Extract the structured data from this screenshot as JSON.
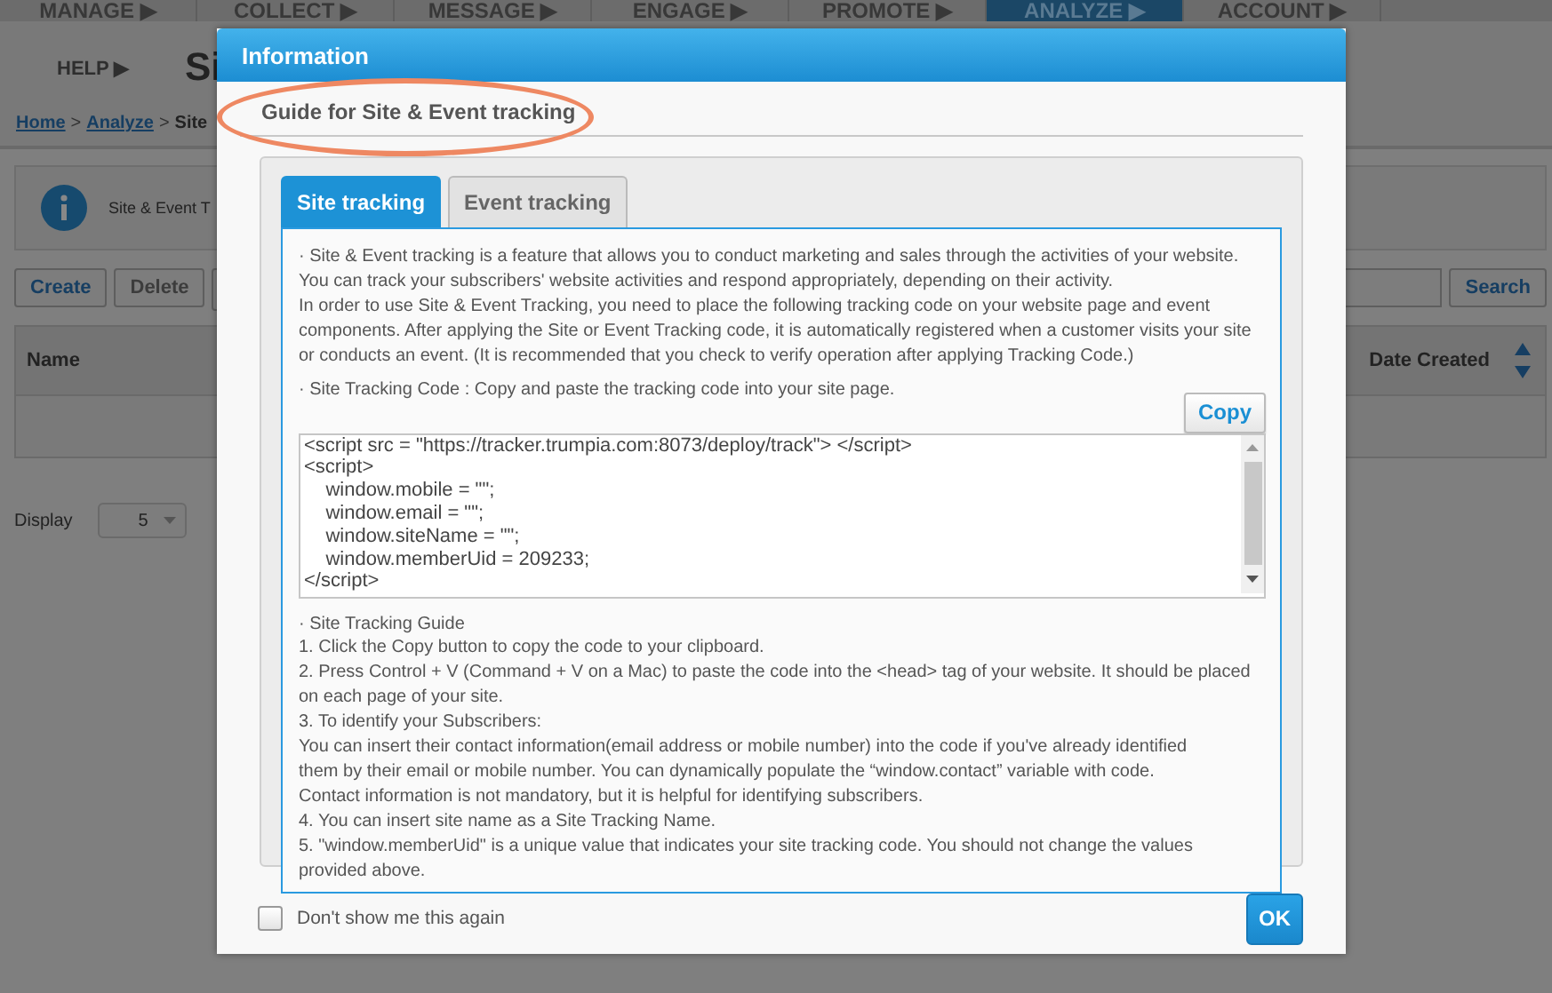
{
  "top_nav": [
    {
      "label": "MANAGE ▶",
      "selected": false
    },
    {
      "label": "COLLECT ▶",
      "selected": false
    },
    {
      "label": "MESSAGE ▶",
      "selected": false
    },
    {
      "label": "ENGAGE ▶",
      "selected": false
    },
    {
      "label": "PROMOTE ▶",
      "selected": false
    },
    {
      "label": "ANALYZE ▶",
      "selected": true
    },
    {
      "label": "ACCOUNT ▶",
      "selected": false
    }
  ],
  "page": {
    "help": "HELP ▶",
    "title": "Si",
    "breadcrumb": [
      {
        "kind": "link",
        "text": "Home"
      },
      {
        "kind": "sep",
        "text": ">"
      },
      {
        "kind": "link",
        "text": "Analyze"
      },
      {
        "kind": "sep",
        "text": ">"
      },
      {
        "kind": "current",
        "text": "Site"
      }
    ],
    "info_text": "Site & Event T",
    "toolbar": [
      {
        "label": "Create",
        "disabled": false
      },
      {
        "label": "Delete",
        "disabled": true
      }
    ],
    "search_button": "Search",
    "columns": [
      "Name",
      "Date Created"
    ],
    "display_label": "Display",
    "display_value": "5"
  },
  "dialog": {
    "title": "Information",
    "heading": "Guide for Site & Event tracking",
    "tabs": [
      {
        "label": "Site tracking",
        "selected": true
      },
      {
        "label": "Event tracking",
        "selected": false
      }
    ],
    "intro": [
      "· Site & Event tracking is a feature that allows you to conduct marketing and sales through the activities of your website. You can track your subscribers' website activities and respond appropriately, depending on their activity.",
      "In order to use Site & Event Tracking, you need to place the following tracking code on your website page and event components. After applying the Site or Event Tracking code, it is automatically registered when a customer visits your site or conducts an event. (It is recommended that you check to verify operation after applying Tracking Code.)"
    ],
    "code_label": "· Site Tracking Code : Copy and paste the tracking code into your site page.",
    "copy_button": "Copy",
    "code_lines": [
      "<script src = \"https://tracker.trumpia.com:8073/deploy/track\"> </script>",
      "<script>",
      "    window.mobile = \"\";",
      "    window.email = \"\";",
      "    window.siteName = \"\";",
      "    window.memberUid = 209233;",
      "</script>"
    ],
    "guide": [
      "· Site Tracking Guide",
      "1. Click the Copy button to copy the code to your clipboard.",
      "2. Press Control + V (Command + V on a Mac) to paste the code into the <head> tag of your website. It should be placed on each page of your site.",
      "3. To identify your Subscribers:",
      "You can insert their contact information(email address or mobile number) into the code if you've already identified",
      "them by their email or mobile number. You can dynamically populate the “window.contact” variable with code.",
      "Contact information is not mandatory, but it is helpful for identifying subscribers.",
      "4. You can insert site name as a Site Tracking Name.",
      "5. \"window.memberUid\" is a unique value that indicates your site tracking code. You should not change the values provided above."
    ],
    "dont_show": {
      "label": "Don't show me this again",
      "checked": false
    },
    "ok_button": "OK"
  }
}
